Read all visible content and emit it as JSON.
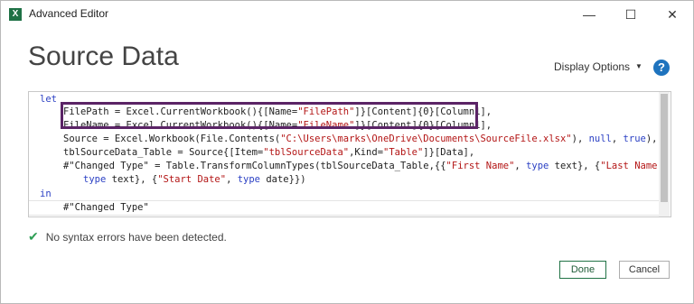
{
  "window": {
    "title": "Advanced Editor",
    "app_icon": "X",
    "minimize": "—",
    "maximize": "☐",
    "close": "✕"
  },
  "header": {
    "title": "Source Data",
    "display_options": "Display Options",
    "help": "?"
  },
  "editor": {
    "lines": [
      "let",
      "FilePath = Excel.CurrentWorkbook(){[Name=\"FilePath\"]}[Content]{0}[Column1],",
      "FileName = Excel.CurrentWorkbook(){[Name=\"FileName\"]}[Content]{0}[Column1],",
      "Source = Excel.Workbook(File.Contents(\"C:\\Users\\marks\\OneDrive\\Documents\\SourceFile.xlsx\"), null, true),",
      "tblSourceData_Table = Source{[Item=\"tblSourceData\",Kind=\"Table\"]}[Data],",
      "#\"Changed Type\" = Table.TransformColumnTypes(tblSourceData_Table,{{\"First Name\", type text}, {\"Last Name\",",
      "type text}, {\"Start Date\", type date}})",
      "in",
      "#\"Changed Type\""
    ]
  },
  "status": {
    "message": "No syntax errors have been detected."
  },
  "footer": {
    "done": "Done",
    "cancel": "Cancel"
  },
  "colors": {
    "keyword": "#2b40c4",
    "string": "#b31515",
    "highlight_box": "#5b2466",
    "success": "#2e9e55",
    "help": "#1e73be"
  }
}
